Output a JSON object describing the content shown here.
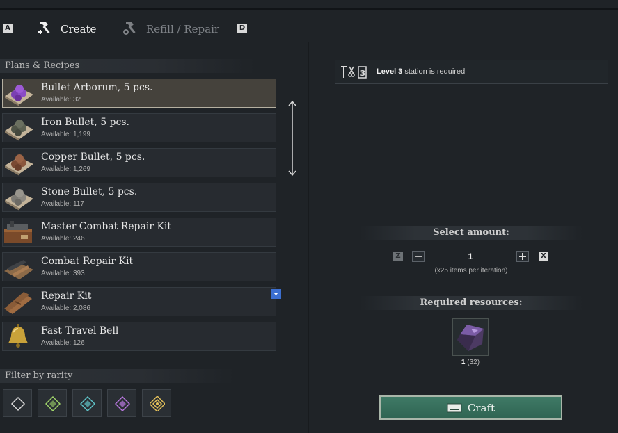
{
  "tabs": {
    "left_key": "A",
    "create_label": "Create",
    "refill_label": "Refill / Repair",
    "right_key": "D"
  },
  "plans": {
    "header": "Plans & Recipes",
    "items": [
      {
        "name": "Bullet Arborum, 5 pcs.",
        "available": "Available: 32",
        "icon": "purple-bullets-icon"
      },
      {
        "name": "Iron Bullet, 5 pcs.",
        "available": "Available: 1,199",
        "icon": "iron-bullets-icon"
      },
      {
        "name": "Copper Bullet, 5 pcs.",
        "available": "Available: 1,269",
        "icon": "copper-bullets-icon"
      },
      {
        "name": "Stone Bullet, 5 pcs.",
        "available": "Available: 117",
        "icon": "stone-bullets-icon"
      },
      {
        "name": "Master Combat Repair Kit",
        "available": "Available: 246",
        "icon": "master-repair-kit-icon"
      },
      {
        "name": "Combat Repair Kit",
        "available": "Available: 393",
        "icon": "combat-repair-kit-icon"
      },
      {
        "name": "Repair Kit",
        "available": "Available: 2,086",
        "icon": "repair-kit-icon"
      },
      {
        "name": "Fast Travel Bell",
        "available": "Available: 126",
        "icon": "bell-icon"
      }
    ]
  },
  "filter": {
    "header": "Filter by rarity",
    "rarities": [
      {
        "icon": "diamond-common-icon",
        "color": "#d8d8d8"
      },
      {
        "icon": "diamond-uncommon-icon",
        "color": "#9fd36a"
      },
      {
        "icon": "diamond-rare-icon",
        "color": "#5fc3c8"
      },
      {
        "icon": "diamond-epic-icon",
        "color": "#b978e0"
      },
      {
        "icon": "diamond-legendary-icon",
        "color": "#e4c15a"
      }
    ]
  },
  "station": {
    "level": "Level 3",
    "text": "station is required"
  },
  "amount": {
    "header": "Select amount:",
    "left_key": "Z",
    "value": "1",
    "right_key": "X",
    "note": "(x25 items per iteration)"
  },
  "resources": {
    "header": "Required resources:",
    "count": "1",
    "have": "(32)",
    "icon": "purple-ore-icon"
  },
  "craft_label": "Craft",
  "colors": {
    "accent": "#3f7a66",
    "selected": "#45423c"
  }
}
